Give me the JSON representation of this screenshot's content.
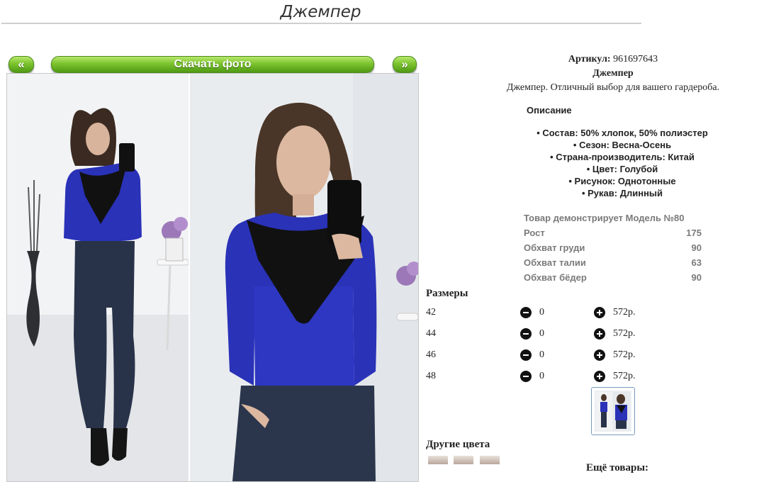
{
  "page": {
    "title": "Джемпер"
  },
  "gallery": {
    "prev_label": "«",
    "download_label": "Скачать фото",
    "next_label": "»"
  },
  "product": {
    "article_label": "Артикул:",
    "article_value": "961697643",
    "name": "Джемпер",
    "description": "Джемпер. Отличный выбор для вашего гардероба.",
    "description_heading": "Описание",
    "features": [
      "• Состав: 50% хлопок, 50% полиэстер",
      "• Сезон: Весна-Осень",
      "• Страна-производитель: Китай",
      "• Цвет: Голубой",
      "• Рисунок: Однотонные",
      "• Рукав: Длинный"
    ]
  },
  "model": {
    "heading": "Товар демонстрирует Модель №80",
    "rows": [
      {
        "label": "Рост",
        "value": "175"
      },
      {
        "label": "Обхват груди",
        "value": "90"
      },
      {
        "label": "Обхват талии",
        "value": "63"
      },
      {
        "label": "Обхват бёдер",
        "value": "90"
      }
    ]
  },
  "sizes": {
    "heading": "Размеры",
    "rows": [
      {
        "size": "42",
        "qty": "0",
        "price": "572р."
      },
      {
        "size": "44",
        "qty": "0",
        "price": "572р."
      },
      {
        "size": "46",
        "qty": "0",
        "price": "572р."
      },
      {
        "size": "48",
        "qty": "0",
        "price": "572р."
      }
    ]
  },
  "other_colors": {
    "heading": "Другие цвета"
  },
  "more_products": {
    "heading": "Ещё товары:"
  },
  "colors": {
    "accent_green": "#7cc32e",
    "jumper_blue": "#2a32b8",
    "lace_black": "#111111"
  }
}
